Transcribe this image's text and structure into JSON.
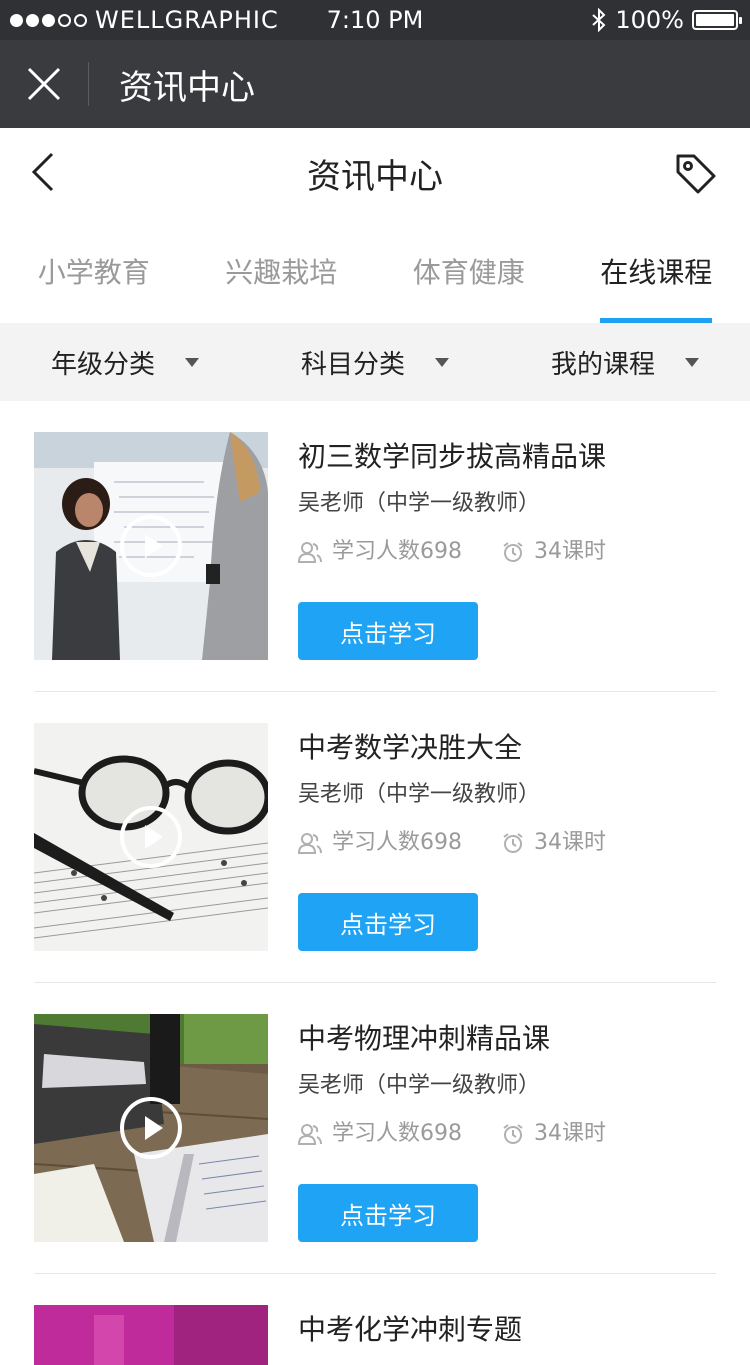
{
  "status_bar": {
    "carrier": "WELLGRAPHIC",
    "time": "7:10 PM",
    "battery": "100%"
  },
  "app_header": {
    "title": "资讯中心"
  },
  "nav": {
    "title": "资讯中心"
  },
  "tabs": [
    {
      "label": "小学教育",
      "active": false
    },
    {
      "label": "兴趣栽培",
      "active": false
    },
    {
      "label": "体育健康",
      "active": false
    },
    {
      "label": "在线课程",
      "active": true
    }
  ],
  "filters": [
    {
      "label": "年级分类"
    },
    {
      "label": "科目分类"
    },
    {
      "label": "我的课程"
    }
  ],
  "courses": [
    {
      "title": "初三数学同步拔高精品课",
      "teacher": "吴老师（中学一级教师）",
      "learners": "学习人数698",
      "hours": "34课时",
      "button": "点击学习",
      "thumb_colors": [
        "#e8ebee",
        "#3a3c40",
        "#b9856b"
      ]
    },
    {
      "title": "中考数学决胜大全",
      "teacher": "吴老师（中学一级教师）",
      "learners": "学习人数698",
      "hours": "34课时",
      "button": "点击学习",
      "thumb_colors": [
        "#f2f2f0",
        "#1c1c1c",
        "#cfcfcb"
      ]
    },
    {
      "title": "中考物理冲刺精品课",
      "teacher": "吴老师（中学一级教师）",
      "learners": "学习人数698",
      "hours": "34课时",
      "button": "点击学习",
      "thumb_colors": [
        "#6e5b45",
        "#3a3a3a",
        "#e8e8ea"
      ]
    },
    {
      "title": "中考化学冲刺专题",
      "thumb_colors": [
        "#c02b9b"
      ]
    }
  ],
  "colors": {
    "accent": "#1da1f2",
    "button": "#1fa3f5",
    "header_dark": "#393b3f"
  }
}
